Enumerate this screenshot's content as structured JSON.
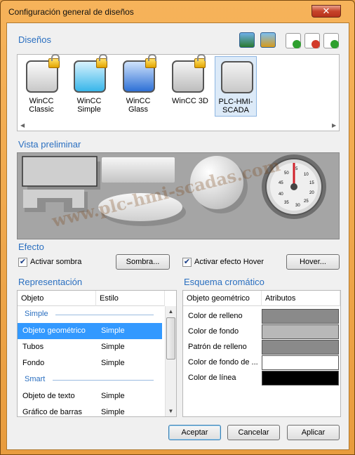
{
  "window": {
    "title": "Configuración general de diseños",
    "close_glyph": "✕"
  },
  "designs": {
    "section_title": "Diseños",
    "toolbar_icons": [
      "import-icon",
      "export-icon",
      "add-icon",
      "remove-icon",
      "refresh-icon"
    ],
    "items": [
      {
        "label_line1": "WinCC",
        "label_line2": "Classic",
        "locked": true,
        "style": "classic",
        "selected": false
      },
      {
        "label_line1": "WinCC",
        "label_line2": "Simple",
        "locked": true,
        "style": "simple",
        "selected": false
      },
      {
        "label_line1": "WinCC",
        "label_line2": "Glass",
        "locked": true,
        "style": "glass",
        "selected": false
      },
      {
        "label_line1": "",
        "label_line2": "WinCC 3D",
        "locked": true,
        "style": "w3d",
        "selected": false
      },
      {
        "label_line1": "PLC-HMI-",
        "label_line2": "SCADA",
        "locked": false,
        "style": "scada",
        "selected": true
      }
    ]
  },
  "preview": {
    "section_title": "Vista preliminar",
    "gauge_numbers": [
      "5",
      "10",
      "15",
      "20",
      "25",
      "30",
      "35",
      "40",
      "45",
      "50"
    ]
  },
  "effect": {
    "section_title": "Efecto",
    "shadow_checkbox_label": "Activar sombra",
    "shadow_checked": true,
    "shadow_button": "Sombra...",
    "hover_checkbox_label": "Activar efecto Hover",
    "hover_checked": true,
    "hover_button": "Hover..."
  },
  "representation": {
    "section_title": "Representación",
    "columns": [
      "Objeto",
      "Estilo"
    ],
    "groups": [
      {
        "name": "Simple",
        "rows": [
          {
            "objeto": "Objeto geométrico",
            "estilo": "Simple",
            "selected": true
          },
          {
            "objeto": "Tubos",
            "estilo": "Simple",
            "selected": false
          },
          {
            "objeto": "Fondo",
            "estilo": "Simple",
            "selected": false
          }
        ]
      },
      {
        "name": "Smart",
        "rows": [
          {
            "objeto": "Objeto de texto",
            "estilo": "Simple",
            "selected": false
          },
          {
            "objeto": "Gráfico de barras",
            "estilo": "Simple",
            "selected": false
          }
        ]
      }
    ]
  },
  "color_scheme": {
    "section_title": "Esquema cromático",
    "columns": [
      "Objeto geométrico",
      "Atributos"
    ],
    "rows": [
      {
        "name": "Color de relleno",
        "color": "#8a8a8a"
      },
      {
        "name": "Color de fondo",
        "color": "#b8b8b8"
      },
      {
        "name": "Patrón de relleno",
        "color": "#8a8a8a"
      },
      {
        "name": "Color de fondo de ...",
        "color": "#ffffff"
      },
      {
        "name": "Color de línea",
        "color": "#000000"
      }
    ]
  },
  "footer": {
    "accept": "Aceptar",
    "cancel": "Cancelar",
    "apply": "Aplicar"
  },
  "watermark": "www.plc-hmi-scadas.com"
}
